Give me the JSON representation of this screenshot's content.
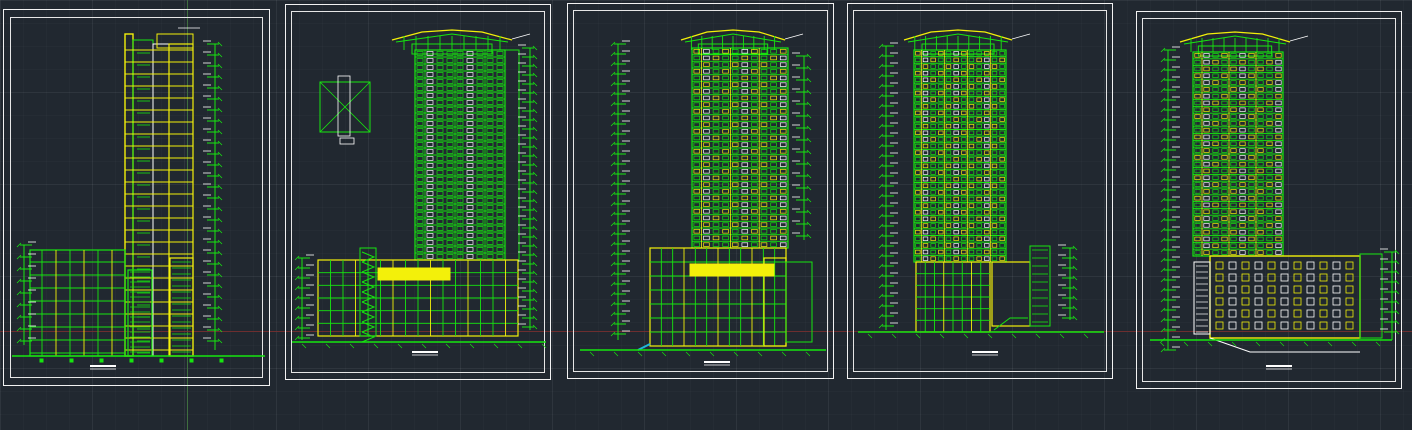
{
  "app": {
    "name": ""
  },
  "colors": {
    "background": "#212830",
    "frame": "#f2f2f2",
    "green": "#16e60f",
    "yellow": "#f3f00a",
    "white": "#ffffff",
    "red_axis": "#7a2f2f",
    "green_axis": "#3f6e3f",
    "cyan": "#1fb6d9"
  },
  "sheets": [
    {
      "id": "section-1",
      "kind": "section",
      "title": ""
    },
    {
      "id": "elevation-1",
      "kind": "elevation",
      "title": ""
    },
    {
      "id": "elevation-2",
      "kind": "elevation",
      "title": ""
    },
    {
      "id": "elevation-3",
      "kind": "elevation",
      "title": ""
    },
    {
      "id": "elevation-4",
      "kind": "elevation",
      "title": ""
    }
  ]
}
